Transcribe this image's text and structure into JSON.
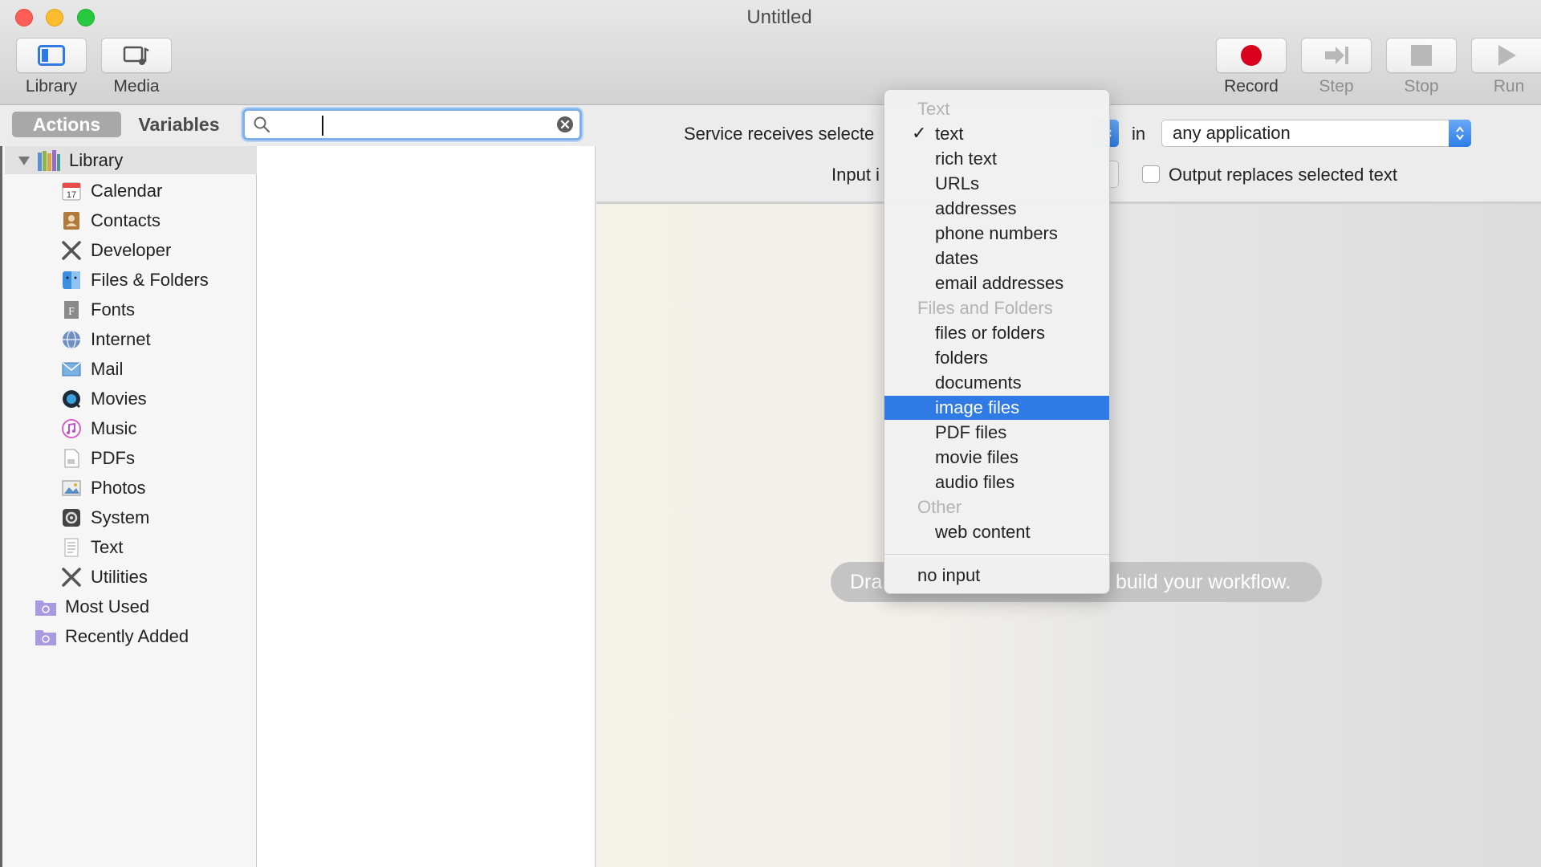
{
  "window": {
    "title": "Untitled"
  },
  "toolbar": {
    "library_label": "Library",
    "media_label": "Media",
    "record_label": "Record",
    "step_label": "Step",
    "stop_label": "Stop",
    "run_label": "Run"
  },
  "tabs": {
    "actions": "Actions",
    "variables": "Variables"
  },
  "search": {
    "value": "",
    "placeholder": ""
  },
  "library": {
    "root": "Library",
    "items": [
      {
        "label": "Calendar",
        "icon": "calendar-icon"
      },
      {
        "label": "Contacts",
        "icon": "contacts-icon"
      },
      {
        "label": "Developer",
        "icon": "developer-icon"
      },
      {
        "label": "Files & Folders",
        "icon": "finder-icon"
      },
      {
        "label": "Fonts",
        "icon": "fonts-icon"
      },
      {
        "label": "Internet",
        "icon": "globe-icon"
      },
      {
        "label": "Mail",
        "icon": "mail-icon"
      },
      {
        "label": "Movies",
        "icon": "movies-icon"
      },
      {
        "label": "Music",
        "icon": "music-icon"
      },
      {
        "label": "PDFs",
        "icon": "pdf-icon"
      },
      {
        "label": "Photos",
        "icon": "photos-icon"
      },
      {
        "label": "System",
        "icon": "system-icon"
      },
      {
        "label": "Text",
        "icon": "text-icon"
      },
      {
        "label": "Utilities",
        "icon": "utilities-icon"
      }
    ],
    "smart_folders": [
      {
        "label": "Most Used"
      },
      {
        "label": "Recently Added"
      }
    ]
  },
  "service": {
    "receives_label": "Service receives selecte",
    "in_label": "in",
    "application_value": "any application",
    "input_label": "Input i",
    "output_replaces_label": "Output replaces selected text"
  },
  "hint": {
    "left": "Dra",
    "right": "build your workflow."
  },
  "menu": {
    "sections": [
      {
        "header": "Text",
        "options": [
          "text",
          "rich text",
          "URLs",
          "addresses",
          "phone numbers",
          "dates",
          "email addresses"
        ]
      },
      {
        "header": "Files and Folders",
        "options": [
          "files or folders",
          "folders",
          "documents",
          "image files",
          "PDF files",
          "movie files",
          "audio files"
        ]
      },
      {
        "header": "Other",
        "options": [
          "web content"
        ]
      }
    ],
    "checked": "text",
    "highlighted": "image files",
    "no_input": "no input"
  },
  "colors": {
    "accent": "#2f7ae5",
    "record": "#d9001b",
    "close": "#fd5f57",
    "minimize": "#febc2e",
    "maximize": "#28c840"
  }
}
